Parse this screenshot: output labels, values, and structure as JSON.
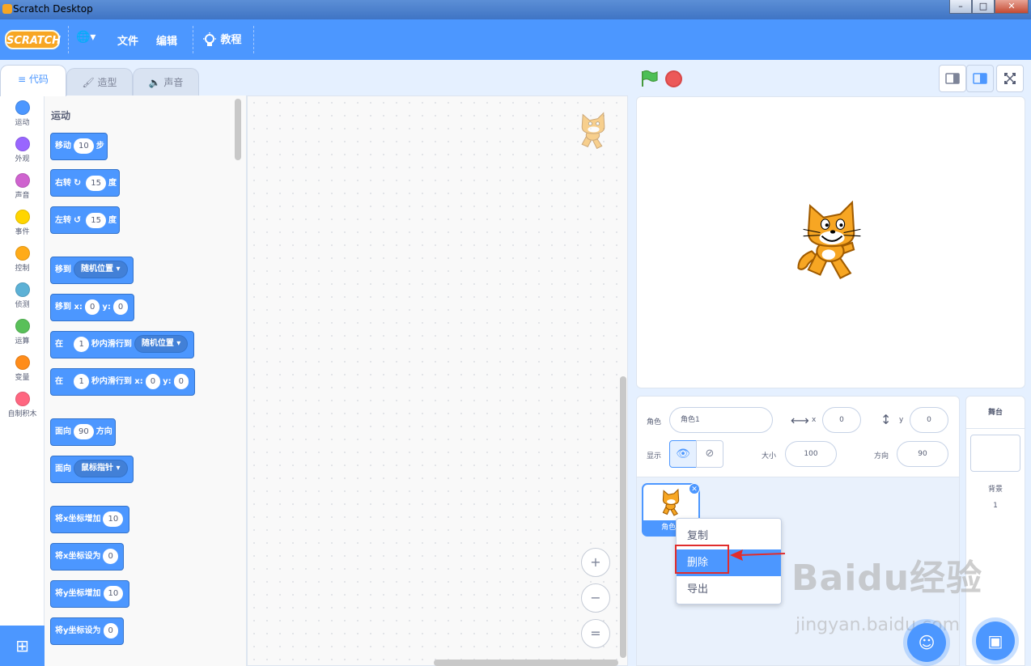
{
  "window": {
    "title": "Scratch Desktop",
    "controls": [
      "–",
      "□",
      "✕"
    ]
  },
  "menubar": {
    "logo": "SCRATCH",
    "lang_glyph": "🌐▾",
    "file": "文件",
    "edit": "编辑",
    "tutorials": "教程"
  },
  "tabs": {
    "code": "代码",
    "costumes": "造型",
    "sounds": "声音"
  },
  "categories": [
    {
      "label": "运动",
      "color": "#4c97ff"
    },
    {
      "label": "外观",
      "color": "#9966ff"
    },
    {
      "label": "声音",
      "color": "#cf63cf"
    },
    {
      "label": "事件",
      "color": "#ffd500"
    },
    {
      "label": "控制",
      "color": "#ffab19"
    },
    {
      "label": "侦测",
      "color": "#5cb1d6"
    },
    {
      "label": "运算",
      "color": "#59c059"
    },
    {
      "label": "变量",
      "color": "#ff8c1a"
    },
    {
      "label": "自制积木",
      "color": "#ff6680"
    }
  ],
  "palette": {
    "title": "运动",
    "move": {
      "a": "移动",
      "v": "10",
      "b": "步"
    },
    "turn_right": {
      "a": "右转",
      "v": "15",
      "b": "度"
    },
    "turn_left": {
      "a": "左转",
      "v": "15",
      "b": "度"
    },
    "goto": {
      "a": "移到",
      "d": "随机位置"
    },
    "goto_xy": {
      "a": "移到 x:",
      "x": "0",
      "b": "y:",
      "y": "0"
    },
    "glide": {
      "a": "在",
      "v": "1",
      "b": "秒内滑行到",
      "d": "随机位置"
    },
    "glide_xy": {
      "a": "在",
      "v": "1",
      "b": "秒内滑行到 x:",
      "x": "0",
      "c": "y:",
      "y": "0"
    },
    "point_dir": {
      "a": "面向",
      "v": "90",
      "b": "方向"
    },
    "point_towards": {
      "a": "面向",
      "d": "鼠标指针"
    },
    "change_x": {
      "a": "将x坐标增加",
      "v": "10"
    },
    "set_x": {
      "a": "将x坐标设为",
      "v": "0"
    },
    "change_y": {
      "a": "将y坐标增加",
      "v": "10"
    },
    "set_y": {
      "a": "将y坐标设为",
      "v": "0"
    }
  },
  "zoom": {
    "in": "+",
    "out": "−",
    "reset": "="
  },
  "sprite_info": {
    "sprite_label": "角色",
    "sprite_name": "角色1",
    "x_label": "x",
    "x_value": "0",
    "y_label": "y",
    "y_value": "0",
    "show_label": "显示",
    "size_label": "大小",
    "size_value": "100",
    "direction_label": "方向",
    "direction_value": "90"
  },
  "sprite_card": {
    "name": "角色1"
  },
  "context_menu": {
    "duplicate": "复制",
    "delete": "删除",
    "export": "导出"
  },
  "stage_panel": {
    "title": "舞台",
    "backdrops_label": "背景",
    "backdrops_count": "1"
  },
  "watermark": {
    "brand": "Baidu经验",
    "url": "jingyan.baidu.com"
  }
}
